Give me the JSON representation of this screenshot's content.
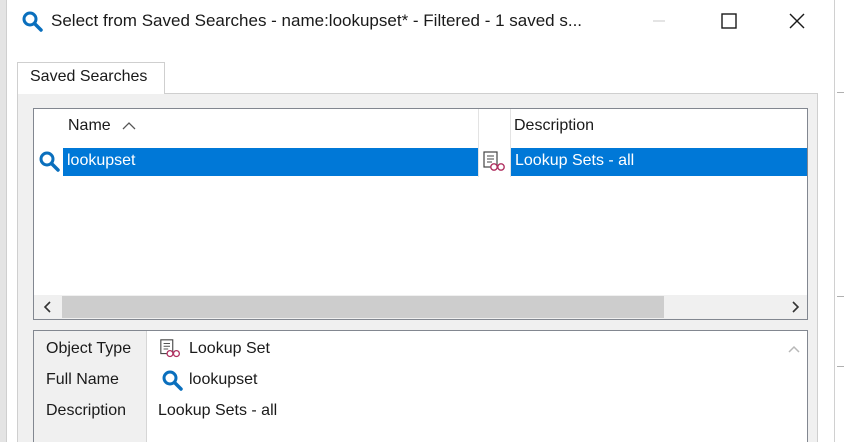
{
  "window": {
    "title": "Select from Saved Searches - name:lookupset* - Filtered - 1 saved s...",
    "icon": "search-icon",
    "controls": {
      "minimize": "minimize-icon",
      "maximize": "maximize-icon",
      "close": "close-icon"
    }
  },
  "tabs": [
    {
      "label": "Saved Searches",
      "selected": true
    }
  ],
  "list": {
    "columns": [
      {
        "label": "Name",
        "sort": "ascending"
      },
      {
        "label": ""
      },
      {
        "label": "Description"
      }
    ],
    "rows": [
      {
        "icon": "search-icon",
        "name": "lookupset",
        "type_icon": "lookup-set-icon",
        "description": "Lookup Sets - all",
        "selected": true
      }
    ]
  },
  "details": {
    "object_type_label": "Object Type",
    "object_type_value": "Lookup Set",
    "full_name_label": "Full Name",
    "full_name_value": "lookupset",
    "description_label": "Description",
    "description_value": "Lookup Sets - all"
  },
  "colors": {
    "selection": "#0078d7",
    "accent_icon": "#0a6fbd",
    "panel_bg": "#f0f0f0"
  }
}
